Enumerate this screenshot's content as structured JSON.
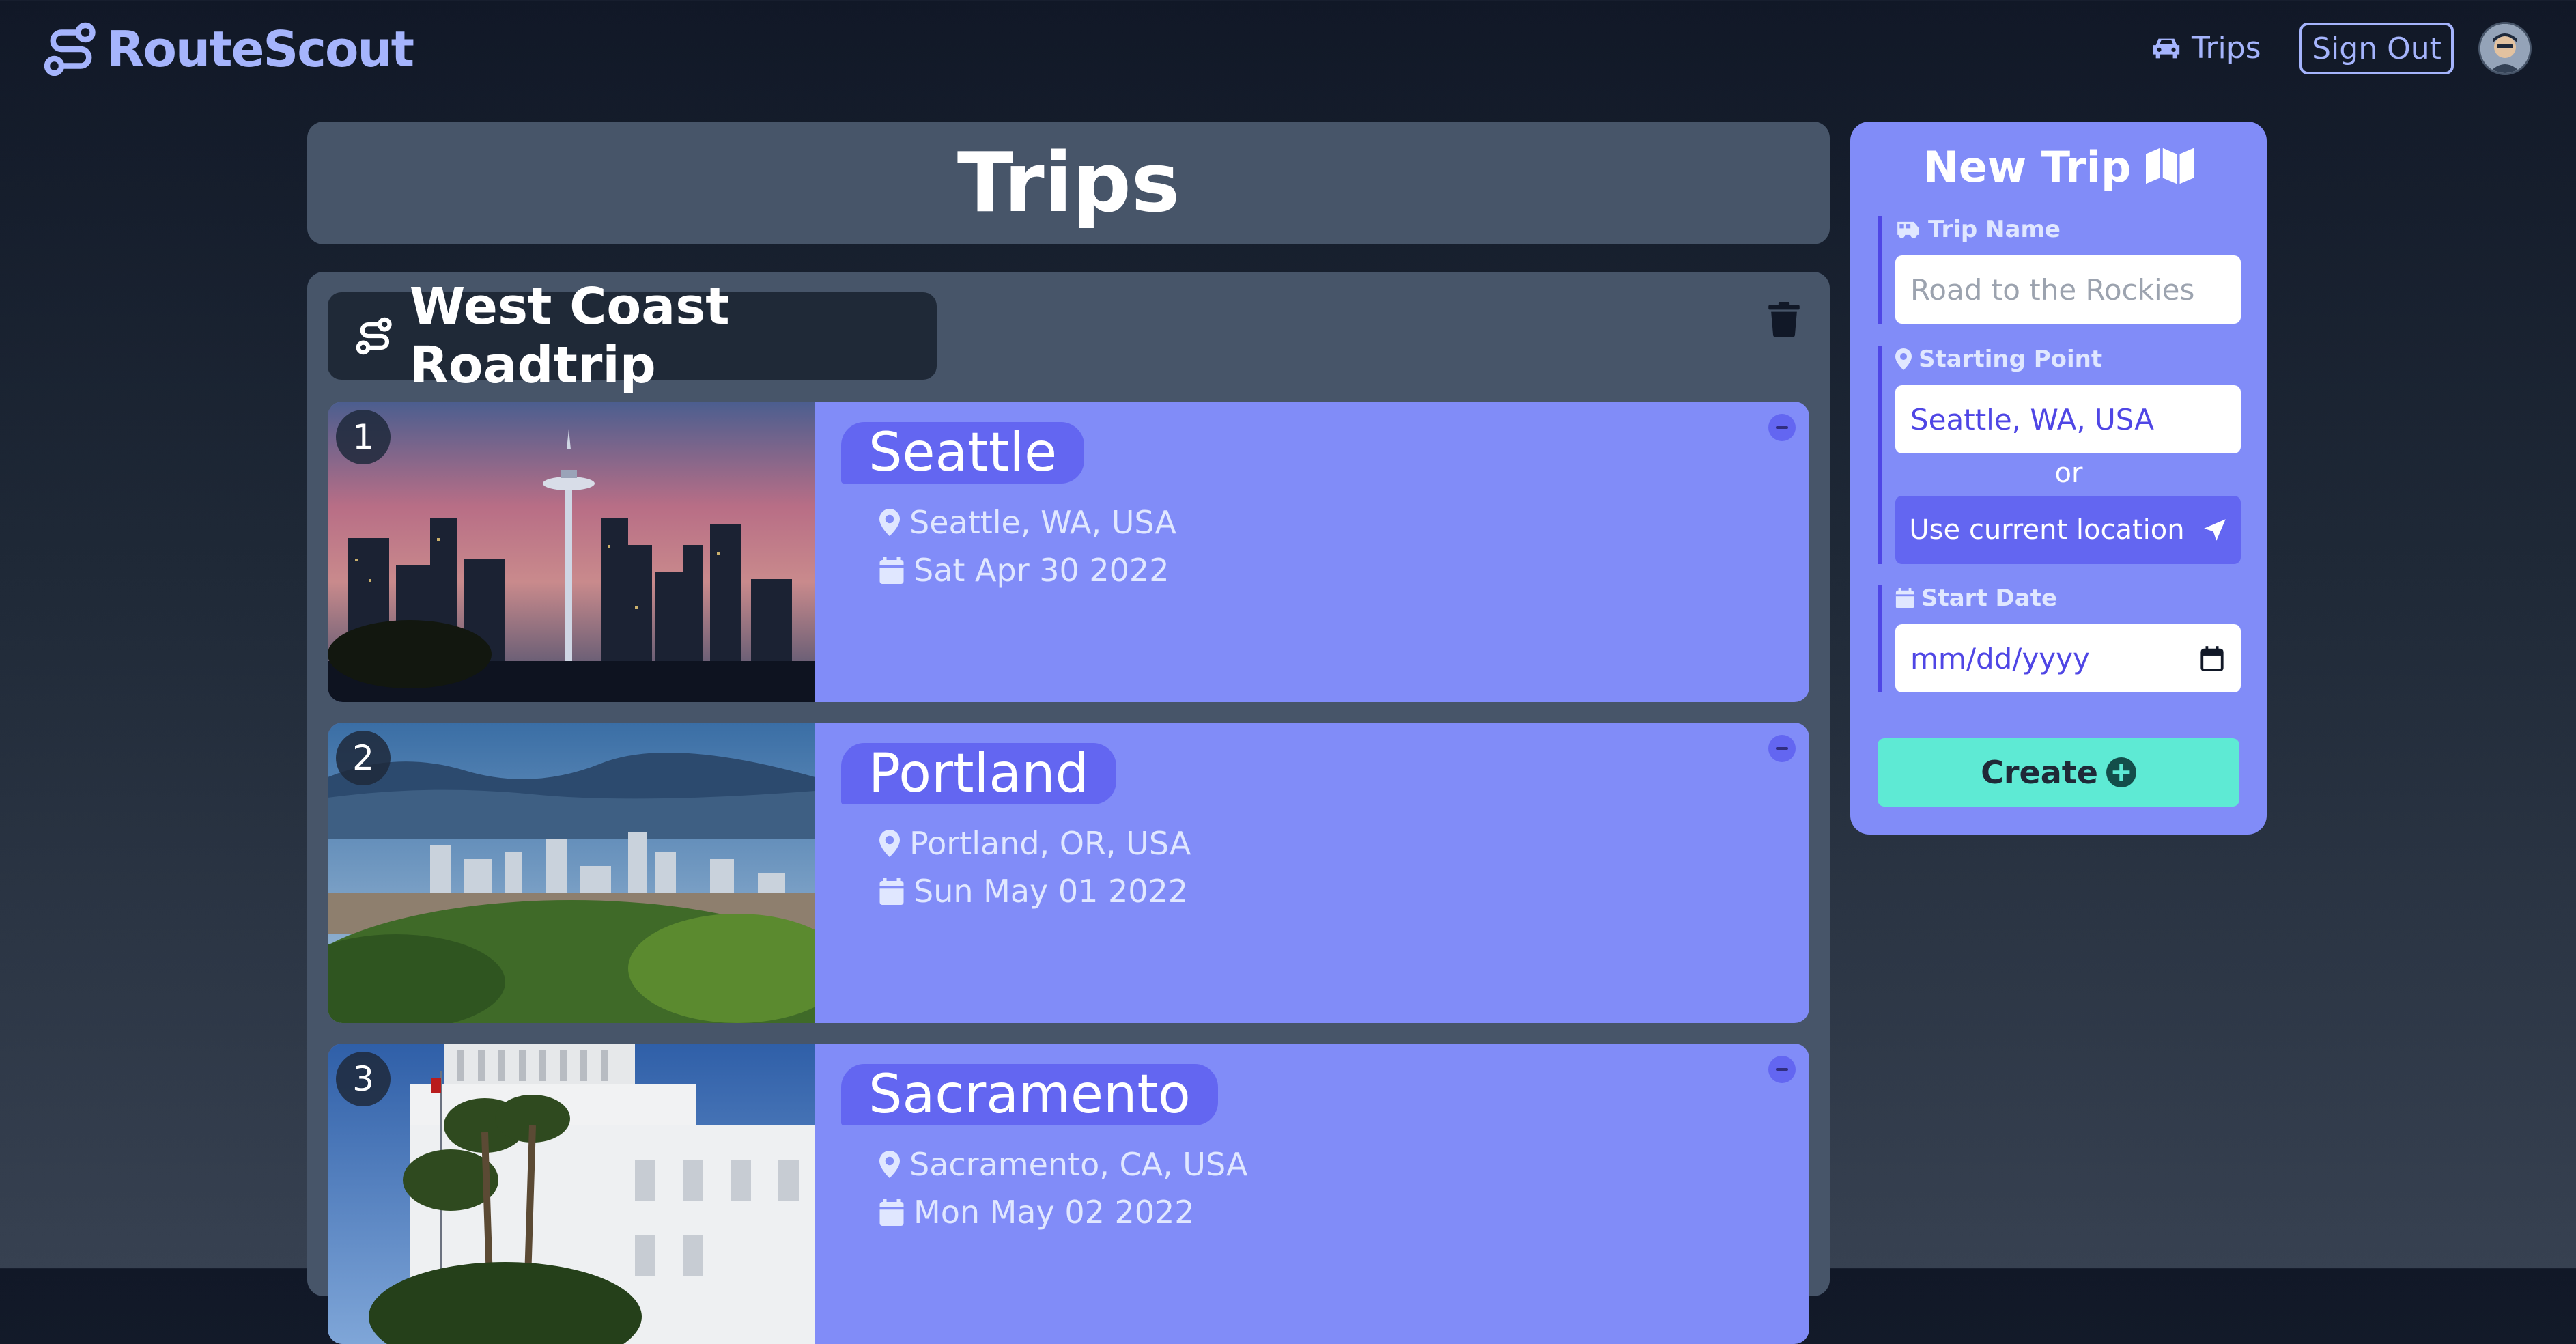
{
  "header": {
    "brand": "RouteScout",
    "nav_trips": "Trips",
    "sign_out": "Sign Out"
  },
  "page": {
    "title": "Trips"
  },
  "trip": {
    "name": "West Coast Roadtrip",
    "stops": [
      {
        "number": "1",
        "name": "Seattle",
        "location": "Seattle, WA, USA",
        "date": "Sat Apr 30 2022"
      },
      {
        "number": "2",
        "name": "Portland",
        "location": "Portland, OR, USA",
        "date": "Sun May 01 2022"
      },
      {
        "number": "3",
        "name": "Sacramento",
        "location": "Sacramento, CA, USA",
        "date": "Mon May 02 2022"
      }
    ]
  },
  "new_trip": {
    "title": "New Trip",
    "trip_name_label": "Trip Name",
    "trip_name_placeholder": "Road to the Rockies",
    "starting_point_label": "Starting Point",
    "starting_point_value": "Seattle, WA, USA",
    "or": "or",
    "use_location": "Use current location",
    "start_date_label": "Start Date",
    "start_date_placeholder": "mm/dd/yyyy",
    "create": "Create"
  },
  "colors": {
    "accent": "#818cf8",
    "accent_dark": "#6366f1",
    "panel": "#475569",
    "create": "#5eead4"
  }
}
